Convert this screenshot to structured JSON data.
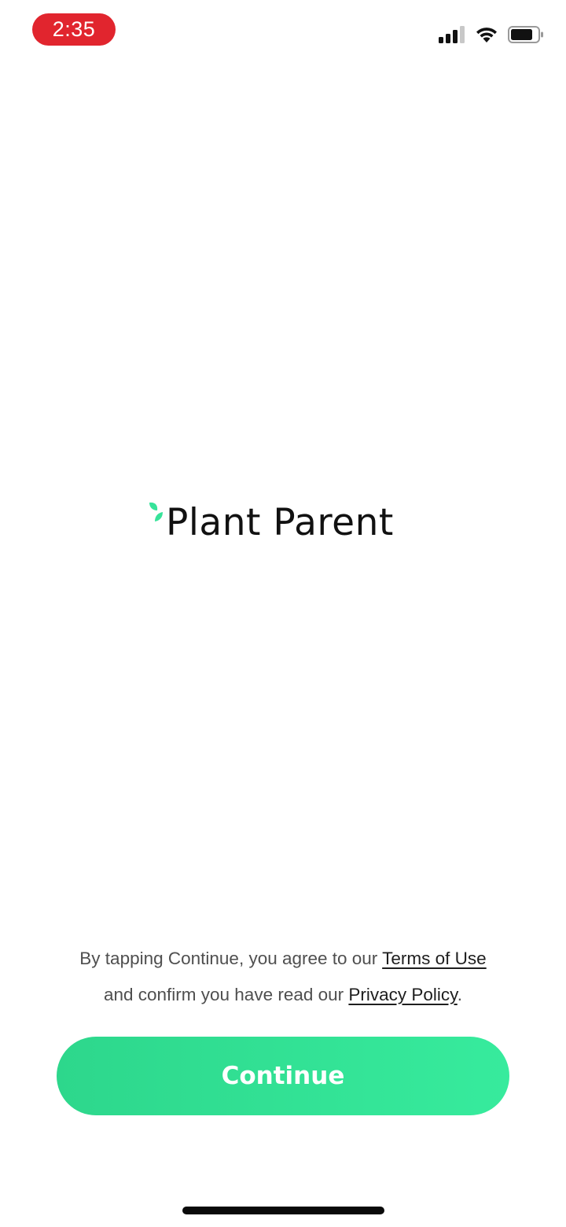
{
  "status_bar": {
    "time": "2:35",
    "time_pill_color": "#e1252e",
    "icons": [
      "cellular-signal-icon",
      "wifi-icon",
      "battery-icon"
    ]
  },
  "logo": {
    "text": "Plant Parent",
    "icon": "leaf-icon",
    "icon_color": "#37e39a"
  },
  "consent": {
    "line1_prefix": "By tapping Continue, you agree to our ",
    "terms_link": "Terms of Use",
    "line2_prefix": "and confirm you have read our ",
    "privacy_link": "Privacy Policy",
    "suffix": "."
  },
  "continue_button": {
    "label": "Continue",
    "color": "#33e197"
  }
}
